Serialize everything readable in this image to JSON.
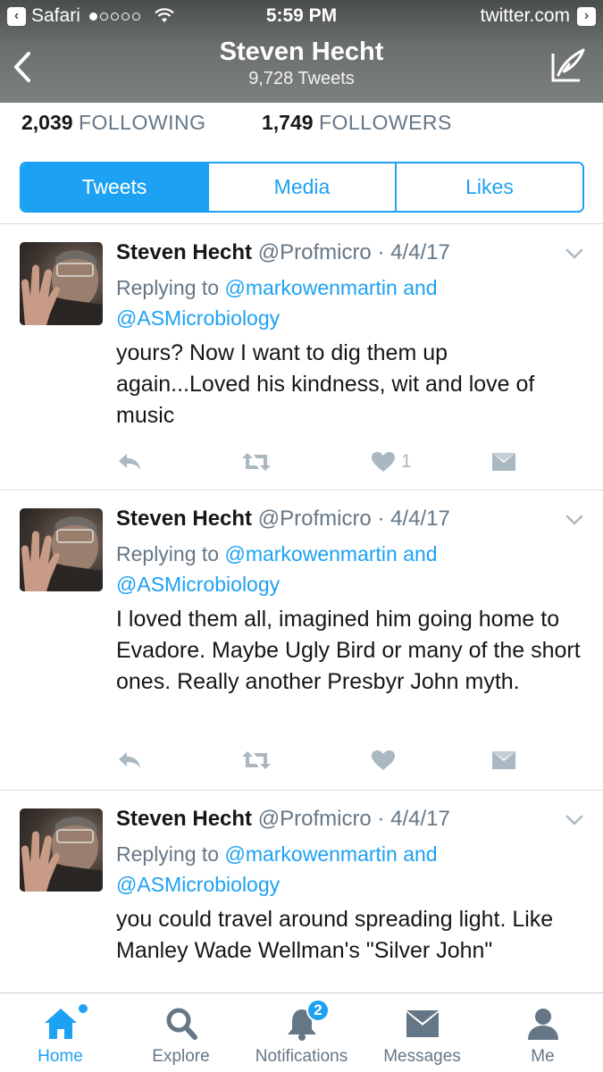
{
  "status_bar": {
    "back_app": "Safari",
    "time": "5:59 PM",
    "url": "twitter.com"
  },
  "header": {
    "name": "Steven Hecht",
    "tweet_count": "9,728 Tweets"
  },
  "stats": {
    "following_count": "2,039",
    "following_label": "FOLLOWING",
    "followers_count": "1,749",
    "followers_label": "FOLLOWERS"
  },
  "tabs": [
    {
      "label": "Tweets",
      "active": true
    },
    {
      "label": "Media",
      "active": false
    },
    {
      "label": "Likes",
      "active": false
    }
  ],
  "tweets": [
    {
      "name": "Steven Hecht",
      "handle": "@Profmicro",
      "date": "4/4/17",
      "replying_prefix": "Replying to ",
      "replying_mention_1": "@markowenmartin",
      "replying_and": " and",
      "replying_mention_2": "@ASMicrobiology",
      "text": "yours? Now I want to dig them up again...Loved his kindness, wit and love of music",
      "likes": "1"
    },
    {
      "name": "Steven Hecht",
      "handle": "@Profmicro",
      "date": "4/4/17",
      "replying_prefix": "Replying to ",
      "replying_mention_1": "@markowenmartin",
      "replying_and": " and",
      "replying_mention_2": "@ASMicrobiology",
      "text": "I loved them all, imagined him going home to Evadore. Maybe Ugly Bird or many of the short ones. Really another Presbyr John myth.",
      "likes": ""
    },
    {
      "name": "Steven Hecht",
      "handle": "@Profmicro",
      "date": "4/4/17",
      "replying_prefix": "Replying to ",
      "replying_mention_1": "@markowenmartin",
      "replying_and": " and",
      "replying_mention_2": "@ASMicrobiology",
      "text": "you could travel around spreading light. Like Manley Wade Wellman's \"Silver John\""
    }
  ],
  "tabbar": {
    "home": "Home",
    "explore": "Explore",
    "notifications": "Notifications",
    "notifications_badge": "2",
    "messages": "Messages",
    "me": "Me"
  },
  "colors": {
    "accent": "#1da1f2",
    "muted": "#657786",
    "icon_gray": "#aab8c2"
  }
}
